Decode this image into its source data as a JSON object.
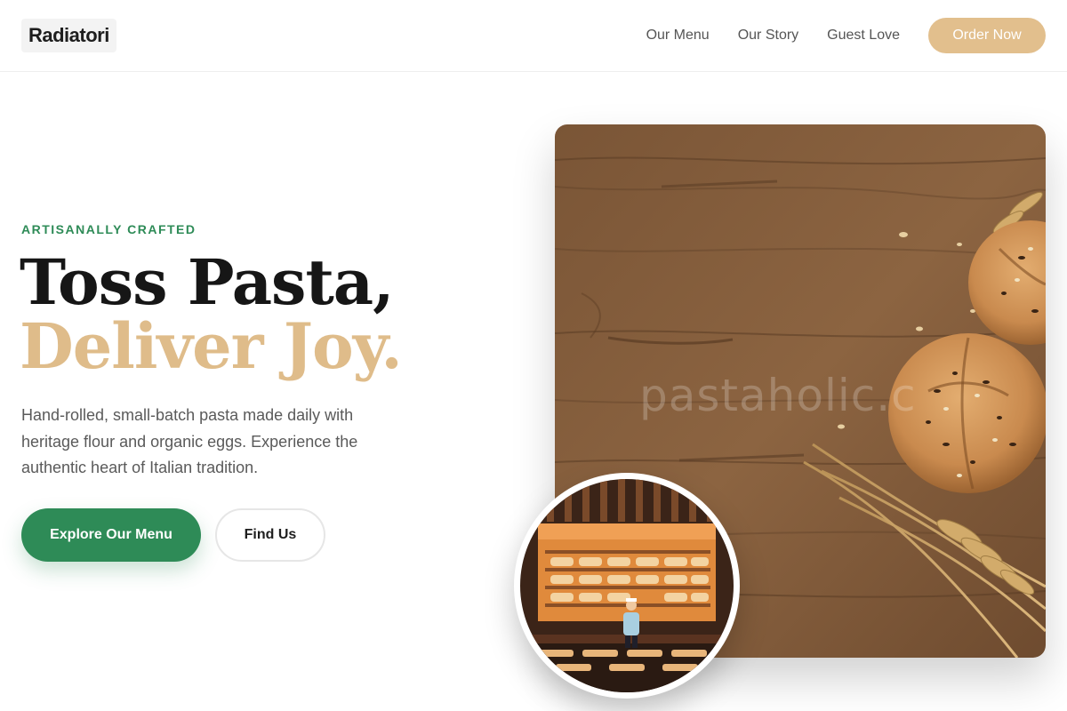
{
  "header": {
    "logo": "Radiatori",
    "nav": [
      "Our Menu",
      "Our Story",
      "Guest Love"
    ],
    "cta": "Order Now"
  },
  "hero": {
    "eyebrow": "ARTISANALLY CRAFTED",
    "headline_line1": "Toss Pasta,",
    "headline_line2": "Deliver Joy.",
    "description": "Hand-rolled, small-batch pasta made daily with heritage flour and organic eggs. Experience the authentic heart of Italian tradition.",
    "primary_button": "Explore Our Menu",
    "secondary_button": "Find Us",
    "image_watermark": "pastaholic.c"
  },
  "colors": {
    "accent_green": "#2e8b57",
    "accent_gold": "#e2bf8d",
    "headline_dark": "#161616"
  }
}
